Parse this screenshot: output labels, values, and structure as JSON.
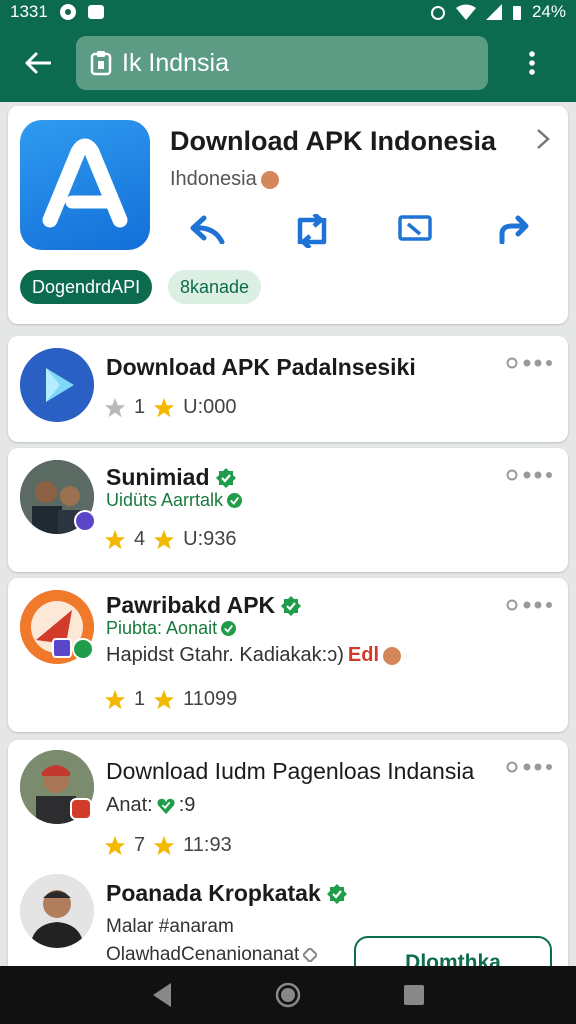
{
  "status_bar": {
    "time": "1331",
    "battery": "24%"
  },
  "toolbar": {
    "search_value": "Ik Indnsia"
  },
  "hero": {
    "title": "Download APK Indonesia",
    "subtitle": "Ihdonesia",
    "chip_primary": "DogendrdAPI",
    "chip_secondary": "8kanade"
  },
  "results": [
    {
      "title": "Download APK Padalnsesiki",
      "rating_a": "1",
      "rating_b": "U:000"
    },
    {
      "title": "Sunimiad",
      "subtitle": "Uidüts Aarrtalk",
      "rating_a": "4",
      "rating_b": "U:936"
    },
    {
      "title": "Pawribakd APK",
      "subtitle": "Piubta: Aonait",
      "description_main": "Hapidst Gtahr. Kadiakak:ɔ) ",
      "description_accent": "Edl",
      "rating_a": "1",
      "rating_b": "11099"
    },
    {
      "title": "Download Iudm Pagenloas Indansia",
      "subtitle": "Anat:",
      "subtitle_value": ":9",
      "rating_a": "7",
      "rating_b": "11:93"
    },
    {
      "title": "Poanada Kropkatak",
      "line1": "Malar #anaram",
      "line2": "OlawhadCenanionanat",
      "button": "Dlomthka"
    }
  ],
  "colors": {
    "primary": "#0c6b4f",
    "accent_red": "#d23a2a",
    "star": "#f5b800"
  }
}
